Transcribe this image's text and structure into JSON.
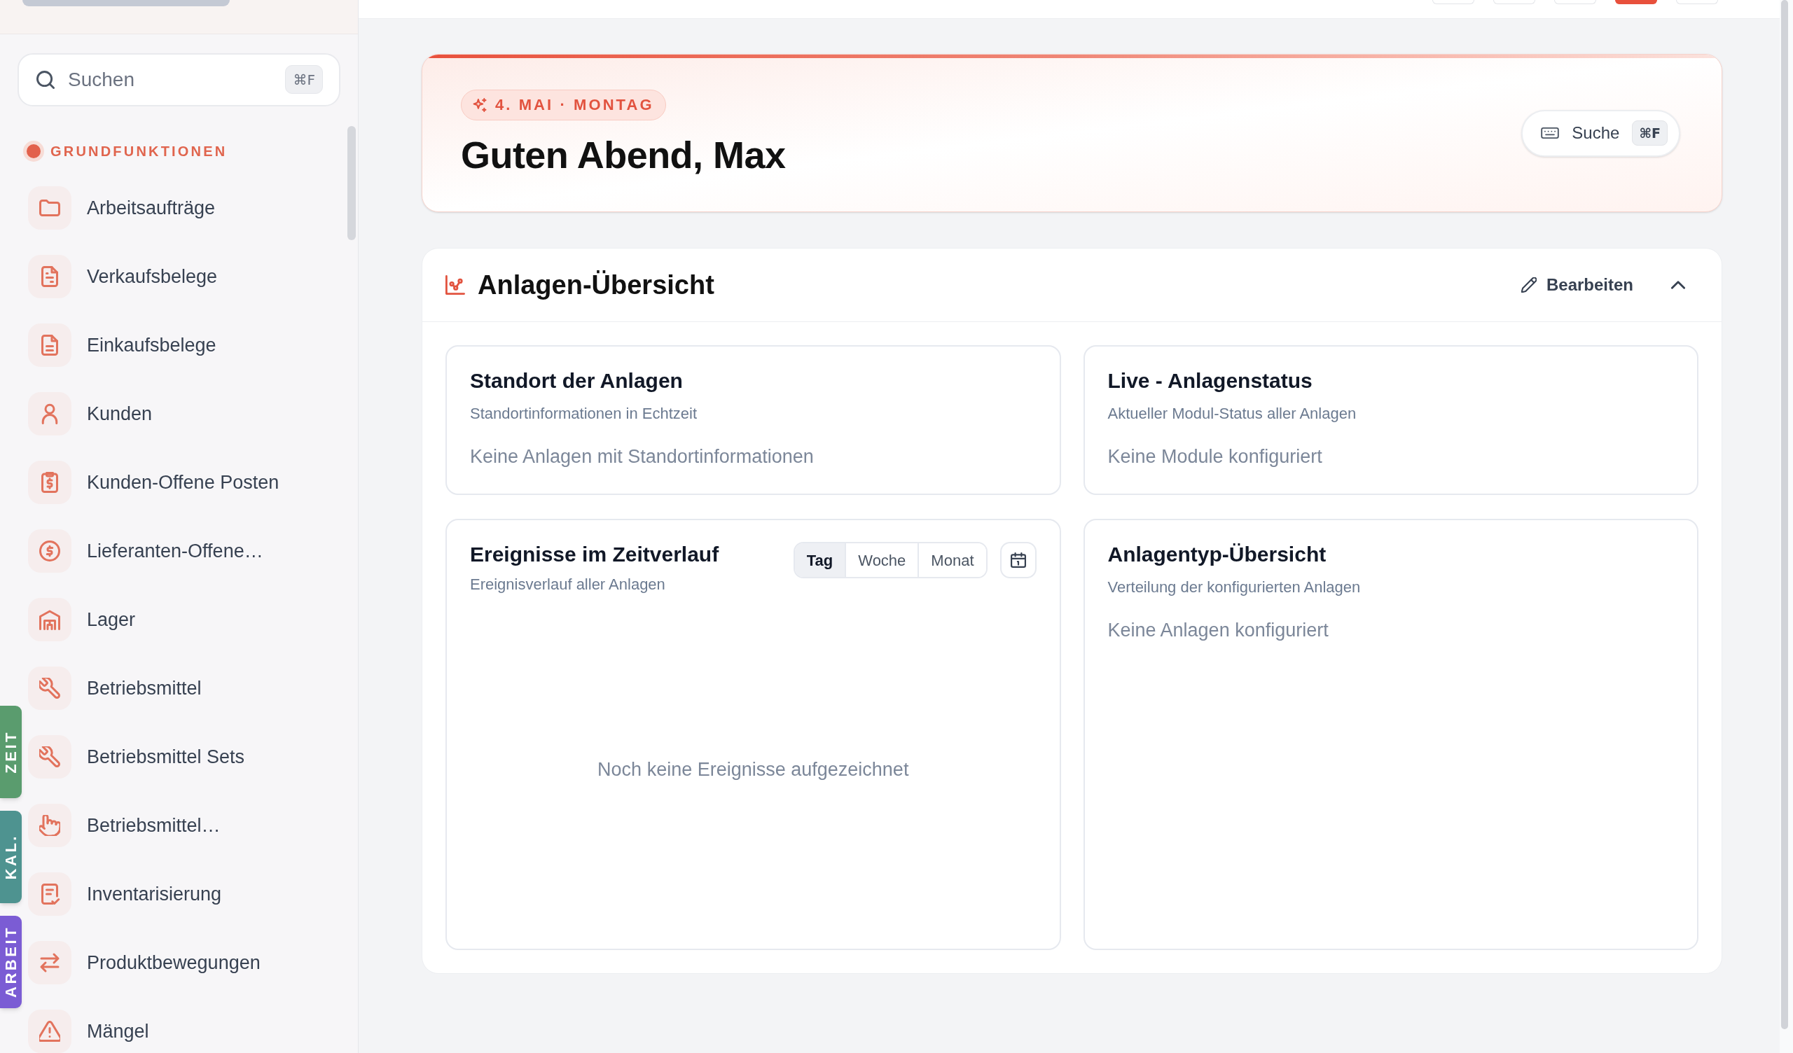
{
  "sidebar": {
    "search": {
      "placeholder": "Suchen",
      "shortcut": "⌘F"
    },
    "section_title": "GRUNDFUNKTIONEN",
    "items": [
      {
        "label": "Arbeitsaufträge"
      },
      {
        "label": "Verkaufsbelege"
      },
      {
        "label": "Einkaufsbelege"
      },
      {
        "label": "Kunden"
      },
      {
        "label": "Kunden-Offene Posten"
      },
      {
        "label": "Lieferanten-Offene…"
      },
      {
        "label": "Lager"
      },
      {
        "label": "Betriebsmittel"
      },
      {
        "label": "Betriebsmittel Sets"
      },
      {
        "label": "Betriebsmittel…"
      },
      {
        "label": "Inventarisierung"
      },
      {
        "label": "Produktbewegungen"
      },
      {
        "label": "Mängel"
      }
    ],
    "side_tabs": [
      {
        "label": "ZEIT",
        "color": "#5a9c6e"
      },
      {
        "label": "KAL.",
        "color": "#4e9390"
      },
      {
        "label": "ARBEIT",
        "color": "#7b5cd4"
      }
    ]
  },
  "toolbar": {
    "buttons": [
      {
        "kind": "plain"
      },
      {
        "kind": "plain"
      },
      {
        "kind": "plain"
      },
      {
        "kind": "accent"
      },
      {
        "kind": "plain"
      }
    ]
  },
  "greeting": {
    "date": "4. MAI · MONTAG",
    "title": "Guten Abend, Max",
    "search_button": {
      "label": "Suche",
      "shortcut": "⌘F"
    }
  },
  "overview": {
    "title": "Anlagen-Übersicht",
    "edit_button": "Bearbeiten",
    "expanded": true,
    "cards": [
      {
        "kind": "info",
        "title": "Standort der Anlagen",
        "subtitle": "Standortinformationen in Echtzeit",
        "empty_text": "Keine Anlagen mit Standortinformationen"
      },
      {
        "kind": "info",
        "title": "Live - Anlagenstatus",
        "subtitle": "Aktueller Modul-Status aller Anlagen",
        "empty_text": "Keine Module konfiguriert"
      },
      {
        "kind": "timeline",
        "title": "Ereignisse im Zeitverlauf",
        "subtitle": "Ereignisverlauf aller Anlagen",
        "ranges": [
          {
            "label": "Tag",
            "selected": true
          },
          {
            "label": "Woche",
            "selected": false
          },
          {
            "label": "Monat",
            "selected": false
          }
        ],
        "empty_text": "Noch keine Ereignisse aufgezeichnet"
      },
      {
        "kind": "info",
        "title": "Anlagentyp-Übersicht",
        "subtitle": "Verteilung der konfigurierten Anlagen",
        "empty_text": "Keine Anlagen konfiguriert"
      }
    ]
  }
}
